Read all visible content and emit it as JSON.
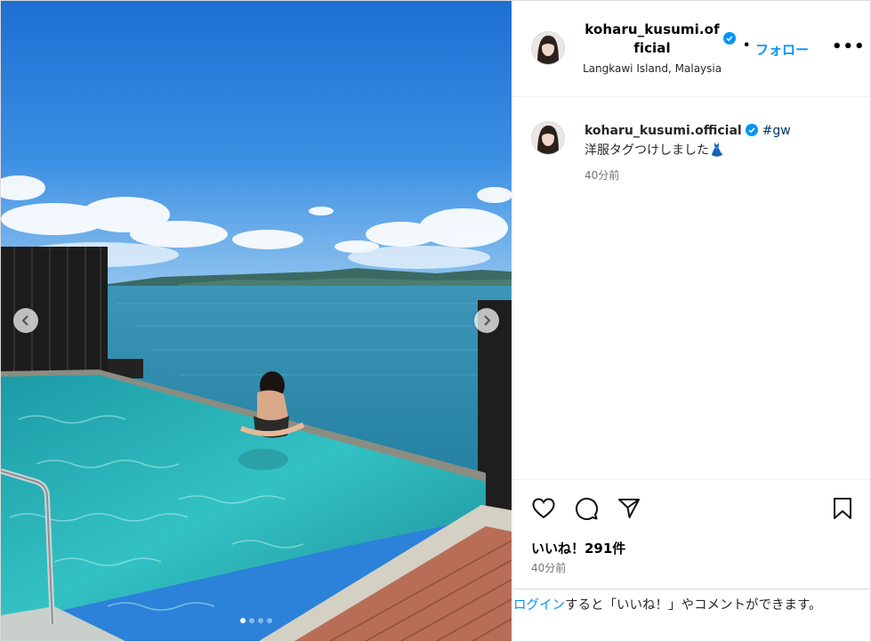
{
  "post": {
    "username": "koharu_kusumi.official",
    "username_wrapped": "koharu_kusumi.official",
    "separator": "•",
    "follow_label": "フォロー",
    "more_label": "•••",
    "location": "Langkawi Island, Malaysia",
    "verified_color": "#0095f6"
  },
  "caption": {
    "username": "koharu_kusumi.official",
    "hashtag": "#gw",
    "text": "洋服タグつけしました👗",
    "time": "40分前"
  },
  "engagement": {
    "likes": "いいね！291件",
    "time": "40分前"
  },
  "login_prompt": {
    "link_text": "ログイン",
    "text": "すると「いいね！」やコメントができます。"
  },
  "carousel": {
    "slide_count": 4,
    "active_index": 0
  },
  "icons": [
    "chevron-left-icon",
    "chevron-right-icon",
    "heart-icon",
    "comment-icon",
    "share-icon",
    "bookmark-icon",
    "verified-icon",
    "more-icon"
  ]
}
